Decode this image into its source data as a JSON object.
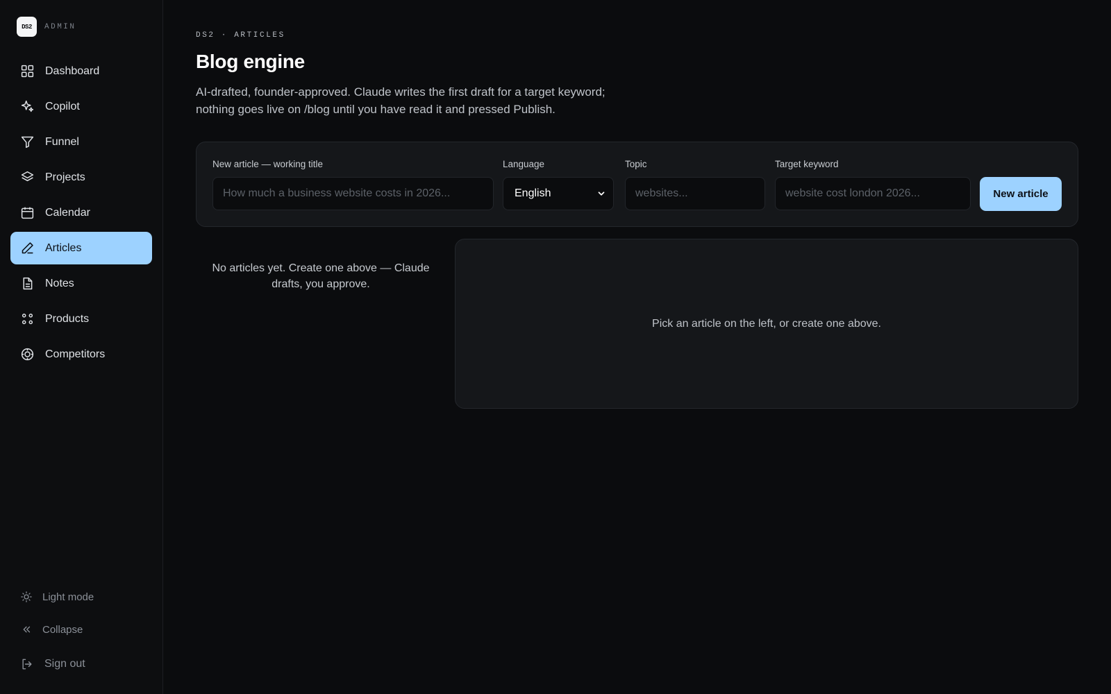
{
  "brand": {
    "logo_text": "DS2",
    "label": "ADMIN"
  },
  "sidebar": {
    "items": [
      {
        "label": "Dashboard",
        "icon": "grid-icon",
        "active": false
      },
      {
        "label": "Copilot",
        "icon": "sparkle-icon",
        "active": false
      },
      {
        "label": "Funnel",
        "icon": "funnel-icon",
        "active": false
      },
      {
        "label": "Projects",
        "icon": "layers-icon",
        "active": false
      },
      {
        "label": "Calendar",
        "icon": "calendar-icon",
        "active": false
      },
      {
        "label": "Articles",
        "icon": "pen-icon",
        "active": true
      },
      {
        "label": "Notes",
        "icon": "document-icon",
        "active": false
      },
      {
        "label": "Products",
        "icon": "dots-grid-icon",
        "active": false
      },
      {
        "label": "Competitors",
        "icon": "target-icon",
        "active": false
      }
    ],
    "light_mode": "Light mode",
    "collapse": "Collapse",
    "sign_out": "Sign out"
  },
  "header": {
    "breadcrumb": "DS2 · ARTICLES",
    "title": "Blog engine",
    "description": "AI-drafted, founder-approved. Claude writes the first draft for a target keyword; nothing goes live on /blog until you have read it and pressed Publish."
  },
  "form": {
    "title_label": "New article — working title",
    "title_placeholder": "How much a business website costs in 2026...",
    "title_value": "",
    "language_label": "Language",
    "language_value": "English",
    "topic_label": "Topic",
    "topic_placeholder": "websites...",
    "topic_value": "",
    "keyword_label": "Target keyword",
    "keyword_placeholder": "website cost london 2026...",
    "keyword_value": "",
    "submit_label": "New article"
  },
  "list": {
    "empty_text": "No articles yet. Create one above — Claude drafts, you approve."
  },
  "detail": {
    "empty_text": "Pick an article on the left, or create one above."
  },
  "colors": {
    "accent": "#9dd2ff",
    "background": "#0b0c0e",
    "panel": "#15171a"
  }
}
